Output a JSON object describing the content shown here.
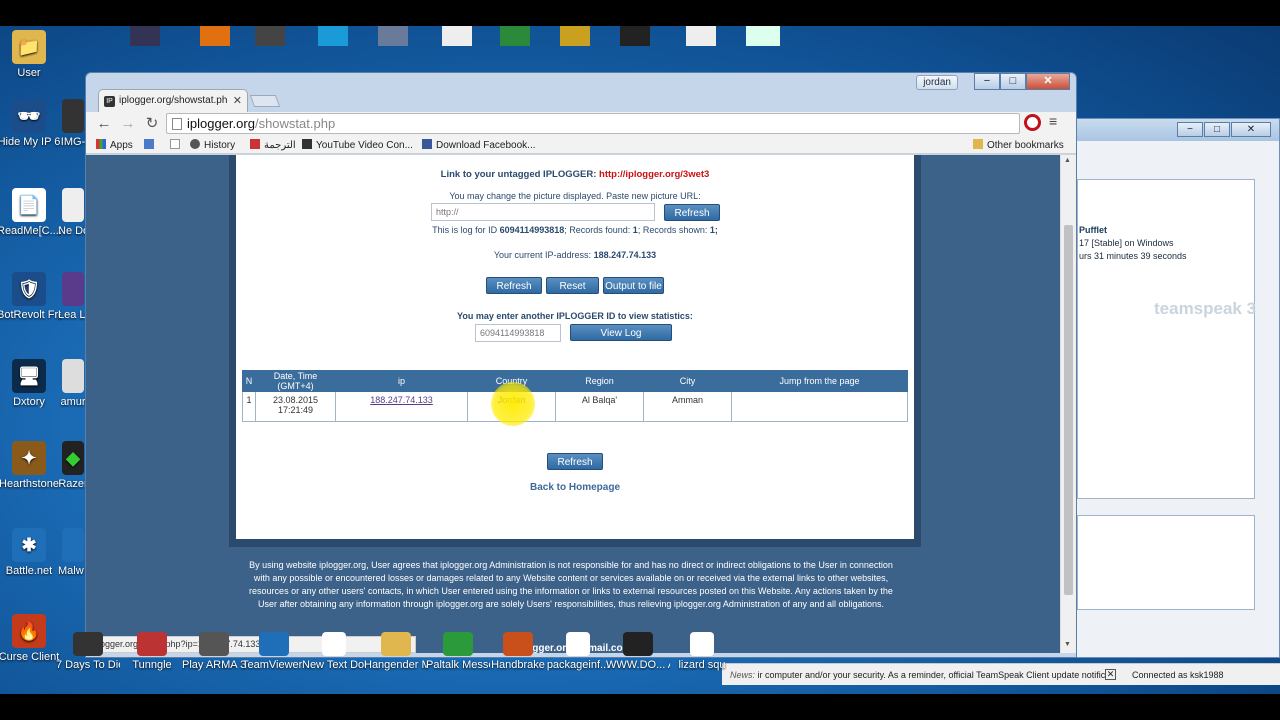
{
  "desktop_icons": [
    {
      "label": "User",
      "color": "#e0b64f",
      "glyph": "📁",
      "icon": "user-folder-icon"
    },
    {
      "label": "Hide My IP 6",
      "color": "#1b4d8a",
      "glyph": "🕶",
      "icon": "hide-my-ip-icon"
    },
    {
      "label": "ReadMe[C...ZIP Passwo...",
      "color": "#ffffff",
      "glyph": "📄",
      "icon": "text-file-icon"
    },
    {
      "label": "BotRevolt Free",
      "color": "#1b4d8a",
      "glyph": "🛡",
      "icon": "botrevolt-icon"
    },
    {
      "label": "Dxtory",
      "color": "#0c2a4a",
      "glyph": "🖥",
      "icon": "dxtory-icon"
    },
    {
      "label": "Hearthstone",
      "color": "#8a5a1a",
      "glyph": "✦",
      "icon": "hearthstone-icon"
    },
    {
      "label": "Battle.net",
      "color": "#1f6fb8",
      "glyph": "✱",
      "icon": "battlenet-icon"
    },
    {
      "label": "Curse Client",
      "color": "#c53a1a",
      "glyph": "🔥",
      "icon": "curse-client-icon"
    }
  ],
  "desktop_icons_col2": [
    {
      "label": "IMG-",
      "color": "#333"
    },
    {
      "label": "Ne Doc",
      "color": "#eee"
    },
    {
      "label": "Lea Leg",
      "color": "#5a3a8a"
    },
    {
      "label": "amur",
      "color": "#ddd"
    },
    {
      "label": "Razer",
      "color": "#222"
    },
    {
      "label": "Malw Anti-",
      "color": "#1f6fb8"
    }
  ],
  "taskbar_icons": [
    {
      "label": "7 Days To Die 10.4 b9 32bit",
      "color": "#333"
    },
    {
      "label": "Tunngle",
      "color": "#b33"
    },
    {
      "label": "Play ARMA 3",
      "color": "#555"
    },
    {
      "label": "TeamViewer 10",
      "color": "#1f6fb8"
    },
    {
      "label": "New Text Docume...",
      "color": "#fff"
    },
    {
      "label": "Hangender Menu",
      "color": "#e0b64f"
    },
    {
      "label": "Paltalk Messenger",
      "color": "#2a9a3a"
    },
    {
      "label": "Handbrake",
      "color": "#c9501a"
    },
    {
      "label": "packageinf...",
      "color": "#fff"
    },
    {
      "label": "WWW.DO... ARK - Surv...",
      "color": "#222"
    },
    {
      "label": "lizard squ",
      "color": "#fff"
    }
  ],
  "teamspeak": {
    "title_controls": {
      "minimize": "−",
      "maximize": "□",
      "close": "✕"
    },
    "server_name": "Pufflet",
    "version": "17 [Stable] on Windows",
    "uptime": "urs 31 minutes 39 seconds",
    "logo": "teamspeak 3",
    "news_label": "News:",
    "news_text": "ir computer and/or your security. As a reminder, official TeamSpeak Client update notific",
    "connection": "Connected as ksk1988"
  },
  "browser": {
    "profile_name": "jordan",
    "tab_title": "iplogger.org/showstat.ph",
    "url_host": "iplogger.org",
    "url_path": "/showstat.php",
    "bookmarks": {
      "apps": "Apps",
      "history": "History",
      "arabic": "الترجمة",
      "youtube": "YouTube Video Con...",
      "facebook": "Download Facebook...",
      "other": "Other bookmarks"
    },
    "status_url": "iplogger.org/map1.php?ip=188.247.74.133"
  },
  "page": {
    "link_label": "Link to your untagged IPLOGGER:",
    "link_url": "http://iplogger.org/3wet3",
    "change_picture": "You may change the picture displayed. Paste new picture URL:",
    "picture_placeholder": "http://",
    "refresh_label": "Refresh",
    "log_info_prefix": "This is log for ID",
    "log_id": "6094114993818",
    "records_found_label": "; Records found:",
    "records_found": "1",
    "records_shown_label": "; Records shown:",
    "records_shown": "1;",
    "current_ip_label": "Your current IP-address:",
    "current_ip": "188.247.74.133",
    "reset_label": "Reset",
    "output_label": "Output to file",
    "another_id_label": "You may enter another IPLOGGER ID to view statistics:",
    "another_id_value": "6094114993818",
    "view_log_label": "View Log",
    "table": {
      "headers": [
        "N",
        "Date, Time (GMT+4)",
        "ip",
        "Country",
        "Region",
        "City",
        "Jump from the page"
      ],
      "rows": [
        {
          "n": "1",
          "date": "23.08.2015",
          "time": "17:21:49",
          "ip": "188.247.74.133",
          "country": "Jordan",
          "region": "Al Balqa'",
          "city": "Amman",
          "jump": ""
        }
      ]
    },
    "back_home": "Back to Homepage",
    "disclaimer": "By using website iplogger.org, User agrees that iplogger.org Administration is not responsible for and has no direct or indirect obligations to the User in connection with any possible or encountered losses or damages related to any Website content or services available on or received via the external links to other websites, resources or any other users' contacts, in which User entered using the information or links to external resources posted on this Website. Any actions taken by the User after obtaining any information through iplogger.org are solely Users' responsibilities, thus relieving iplogger.org Administration of any and all obligations.",
    "email": "iplogger.org@gmail.com"
  }
}
